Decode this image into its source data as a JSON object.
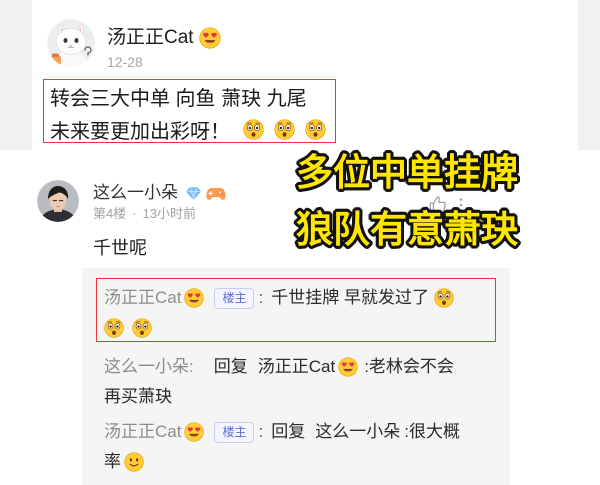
{
  "colors": {
    "highlight_border": "#e53935",
    "caption_fill": "#ffe600",
    "caption_outline": "#111111",
    "badge_text": "#5c6bd6",
    "reply_background": "#f5f5f5",
    "author_gray": "#8c8c8c"
  },
  "top_post": {
    "author": "汤正正Cat",
    "author_emoji": "heart-eyes-emoji",
    "date": "12-28",
    "content_line1": "转会三大中单 向鱼 萧玦 九尾",
    "content_line2": "未来要更加出彩呀！",
    "content_line2_emojis": [
      "astonished-emoji",
      "astonished-emoji",
      "astonished-emoji"
    ]
  },
  "captions": {
    "line1": "多位中单挂牌",
    "line2": "狼队有意萧玦"
  },
  "comment": {
    "author": "这么一小朵",
    "author_badges": [
      "blue-diamond-icon",
      "game-controller-icon"
    ],
    "floor": "第4楼",
    "dot": "·",
    "time": "13小时前",
    "like_icon": "thumbs-up-icon",
    "more_icon": "more-vertical-icon",
    "text": "千世呢"
  },
  "replies": [
    {
      "author": "汤正正Cat",
      "author_emoji": "heart-eyes-emoji",
      "badge": "楼主",
      "colon": ":",
      "line1_text": "千世挂牌 早就发过了",
      "line1_emojis": [
        "astonished-emoji"
      ],
      "line2_emojis": [
        "astonished-emoji",
        "astonished-emoji"
      ]
    },
    {
      "author": "这么一小朵",
      "colon": ":",
      "reply_word": "回复",
      "reply_to": "汤正正Cat",
      "reply_to_emoji": "heart-eyes-emoji",
      "line1_text": ":老林会不会",
      "line2_text": "再买萧玦"
    },
    {
      "author": "汤正正Cat",
      "author_emoji": "heart-eyes-emoji",
      "badge": "楼主",
      "colon": ":",
      "reply_word": "回复",
      "reply_to": "这么一小朵",
      "line1_text": ":很大概",
      "line2_text": "率",
      "line2_emojis": [
        "slightly-smiling-emoji"
      ]
    }
  ]
}
